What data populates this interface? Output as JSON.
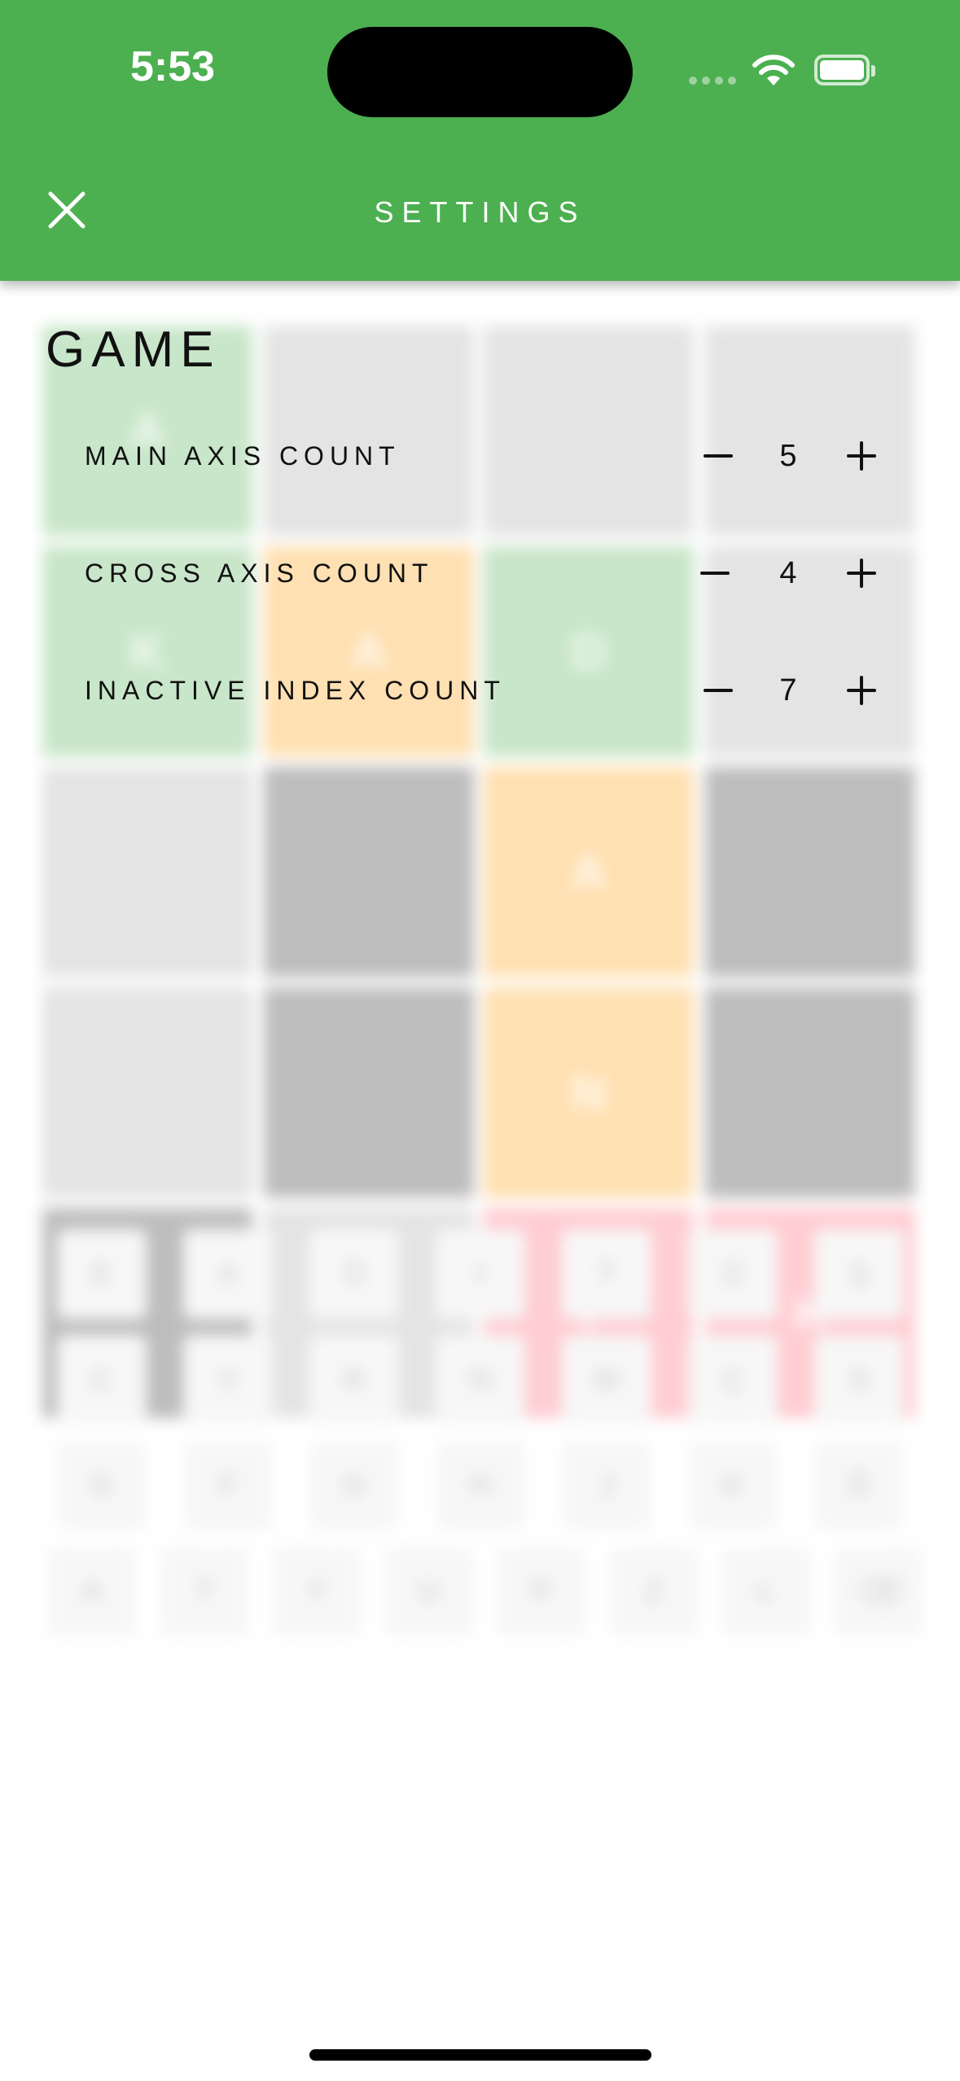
{
  "status_bar": {
    "time": "5:53"
  },
  "header": {
    "title": "SETTINGS",
    "close_icon": "close-icon"
  },
  "section": {
    "title": "GAME"
  },
  "settings": [
    {
      "label": "MAIN AXIS COUNT",
      "value": "5",
      "minus_icon": "minus-icon",
      "plus_icon": "plus-icon"
    },
    {
      "label": "CROSS AXIS COUNT",
      "value": "4",
      "minus_icon": "minus-icon",
      "plus_icon": "plus-icon"
    },
    {
      "label": "INACTIVE INDEX COUNT",
      "value": "7",
      "minus_icon": "minus-icon",
      "plus_icon": "plus-icon"
    }
  ],
  "colors": {
    "header_bg": "#4caf50",
    "tile_empty": "#e4e4e4",
    "tile_inactive": "#bdbdbd",
    "tile_green": "#c8e6c9",
    "tile_orange": "#ffe0b2",
    "tile_red": "#ffcdd2"
  },
  "background_board": {
    "rows": [
      [
        {
          "letter": "A",
          "state": "green"
        },
        {
          "letter": "",
          "state": "empty"
        },
        {
          "letter": "",
          "state": "empty"
        },
        {
          "letter": "",
          "state": "empty"
        }
      ],
      [
        {
          "letter": "K",
          "state": "green"
        },
        {
          "letter": "A",
          "state": "orange"
        },
        {
          "letter": "D",
          "state": "green"
        },
        {
          "letter": "",
          "state": "empty"
        }
      ],
      [
        {
          "letter": "",
          "state": "empty"
        },
        {
          "letter": "",
          "state": "inactive"
        },
        {
          "letter": "A",
          "state": "orange"
        },
        {
          "letter": "",
          "state": "inactive"
        }
      ],
      [
        {
          "letter": "",
          "state": "empty"
        },
        {
          "letter": "",
          "state": "inactive"
        },
        {
          "letter": "N",
          "state": "orange"
        },
        {
          "letter": "",
          "state": "inactive"
        }
      ],
      [
        {
          "letter": "",
          "state": "inactive"
        },
        {
          "letter": "",
          "state": "empty"
        },
        {
          "letter": "T",
          "state": "red"
        },
        {
          "letter": "K",
          "state": "red"
        }
      ]
    ]
  },
  "background_keyboard": {
    "rows": [
      [
        "E",
        "A",
        "Ö",
        "I",
        "T",
        "Ü",
        "Ş"
      ],
      [
        "C",
        "V",
        "R",
        "N",
        "M",
        "Ç",
        "S"
      ],
      [
        "D",
        "F",
        "G",
        "H",
        "J",
        "K",
        "Ğ"
      ],
      [
        "A",
        "T",
        "Y",
        "U",
        "P",
        "Z",
        "L",
        "⌫"
      ]
    ]
  }
}
